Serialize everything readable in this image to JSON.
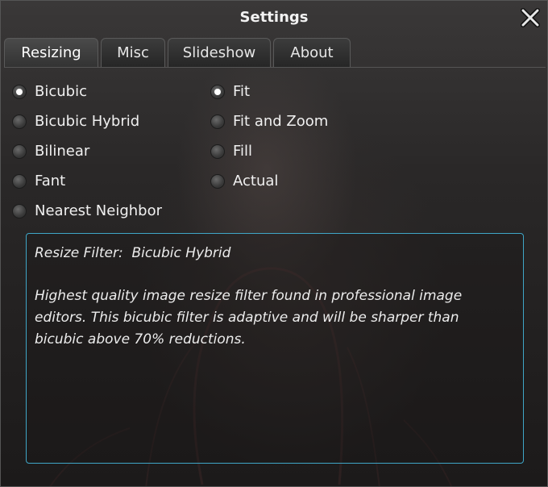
{
  "window": {
    "title": "Settings",
    "close_icon": "close-icon"
  },
  "tabs": [
    {
      "label": "Resizing",
      "active": true
    },
    {
      "label": "Misc",
      "active": false
    },
    {
      "label": "Slideshow",
      "active": false
    },
    {
      "label": "About",
      "active": false
    }
  ],
  "resize_filters": [
    {
      "label": "Bicubic",
      "checked": true
    },
    {
      "label": "Bicubic Hybrid",
      "checked": false
    },
    {
      "label": "Bilinear",
      "checked": false
    },
    {
      "label": "Fant",
      "checked": false
    },
    {
      "label": "Nearest Neighbor",
      "checked": false
    }
  ],
  "fit_modes": [
    {
      "label": "Fit",
      "checked": true
    },
    {
      "label": "Fit and Zoom",
      "checked": false
    },
    {
      "label": "Fill",
      "checked": false
    },
    {
      "label": "Actual",
      "checked": false
    }
  ],
  "description": {
    "title": "Resize Filter:  Bicubic Hybrid",
    "body": "  Highest quality image resize filter found in professional image\neditors. This bicubic filter is adaptive and will be sharper than\nbicubic above 70% reductions."
  },
  "colors": {
    "accent_border": "#3fa6c7",
    "text": "#f0f0f0"
  }
}
